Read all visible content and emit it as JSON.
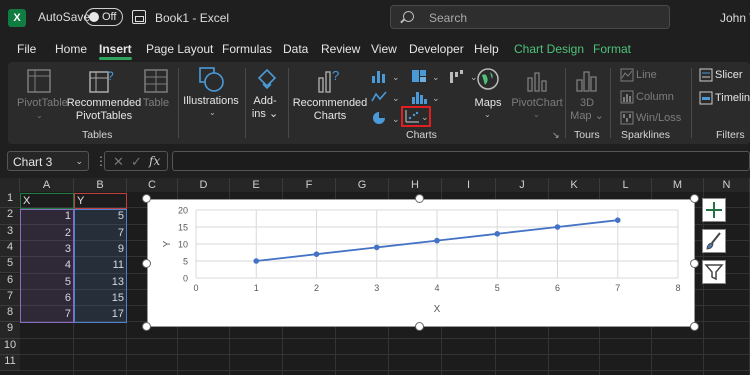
{
  "titlebar": {
    "autosave_label": "AutoSave",
    "autosave_state": "Off",
    "doc_title": "Book1  -  Excel",
    "search_placeholder": "Search",
    "user_name": "John W"
  },
  "menu": {
    "tabs": [
      "File",
      "Home",
      "Insert",
      "Page Layout",
      "Formulas",
      "Data",
      "Review",
      "View",
      "Developer",
      "Help",
      "Chart Design",
      "Format"
    ],
    "active_tab": "Insert"
  },
  "ribbon": {
    "tables": {
      "pivottable": "PivotTable",
      "recommended_pivottables_1": "Recommended",
      "recommended_pivottables_2": "PivotTables",
      "table": "Table",
      "group": "Tables"
    },
    "illustrations": "Illustrations",
    "addins_1": "Add-",
    "addins_2": "ins",
    "charts": {
      "recommended_1": "Recommended",
      "recommended_2": "Charts",
      "maps": "Maps",
      "pivotchart": "PivotChart",
      "group": "Charts"
    },
    "tours": {
      "map_1": "3D",
      "map_2": "Map",
      "group": "Tours"
    },
    "sparklines": {
      "line": "Line",
      "column": "Column",
      "winloss": "Win/Loss",
      "group": "Sparklines"
    },
    "filters": {
      "slicer": "Slicer",
      "timeline": "Timeline",
      "group": "Filters"
    }
  },
  "formula_bar": {
    "name_box": "Chart 3",
    "fx": "fx",
    "cancel": "✕",
    "enter": "✓",
    "dots": "⋮"
  },
  "sheet": {
    "columns": [
      "A",
      "B",
      "C",
      "D",
      "E",
      "F",
      "G",
      "H",
      "I",
      "J",
      "K",
      "L",
      "M",
      "N"
    ],
    "rows": [
      "1",
      "2",
      "3",
      "4",
      "5",
      "6",
      "7",
      "8",
      "9",
      "10",
      "11"
    ],
    "header_x": "X",
    "header_y": "Y",
    "x_values": [
      "1",
      "2",
      "3",
      "4",
      "5",
      "6",
      "7"
    ],
    "y_values": [
      "5",
      "7",
      "9",
      "11",
      "13",
      "15",
      "17"
    ]
  },
  "chart_data": {
    "type": "scatter",
    "x": [
      1,
      2,
      3,
      4,
      5,
      6,
      7
    ],
    "series": [
      {
        "values": [
          5,
          7,
          9,
          11,
          13,
          15,
          17
        ]
      }
    ],
    "xlabel": "X",
    "ylabel": "Y",
    "xlim": [
      0,
      8
    ],
    "ylim": [
      0,
      20
    ],
    "xticks": [
      "0",
      "1",
      "2",
      "3",
      "4",
      "5",
      "6",
      "7",
      "8"
    ],
    "yticks": [
      "0",
      "5",
      "10",
      "15",
      "20"
    ],
    "grid": true,
    "line_color": "#4472c4"
  },
  "chart_side_buttons": [
    "chart-elements",
    "chart-styles",
    "chart-filters"
  ]
}
